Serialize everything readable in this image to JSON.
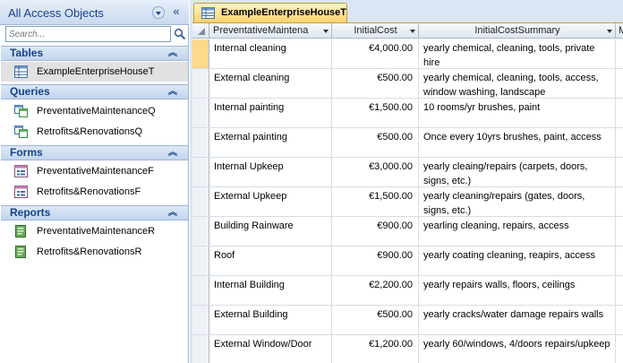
{
  "nav": {
    "title": "All Access Objects",
    "collapse_glyph": "«",
    "search_placeholder": "Search...",
    "groups": [
      {
        "label": "Tables",
        "items": [
          "ExampleEnterpriseHouseT"
        ]
      },
      {
        "label": "Queries",
        "items": [
          "PreventativeMaintenanceQ",
          "Retrofits&RenovationsQ"
        ]
      },
      {
        "label": "Forms",
        "items": [
          "PreventativeMaintenanceF",
          "Retrofits&RenovationsF"
        ]
      },
      {
        "label": "Reports",
        "items": [
          "PreventativeMaintenanceR",
          "Retrofits&RenovationsR"
        ]
      }
    ],
    "selected_item": "ExampleEnterpriseHouseT"
  },
  "document": {
    "tab_label": "ExampleEnterpriseHouseT",
    "columns": [
      "PreventativeMaintena",
      "InitialCost",
      "InitialCostSummary",
      "M"
    ],
    "rows": [
      {
        "name": "Internal cleaning",
        "cost": "€4,000.00",
        "summary": "yearly chemical, cleaning, tools, private hire"
      },
      {
        "name": "External cleaning",
        "cost": "€500.00",
        "summary": "yearly chemical, cleaning, tools, access, window washing, landscape"
      },
      {
        "name": "Internal painting",
        "cost": "€1,500.00",
        "summary": "10 rooms/yr brushes, paint"
      },
      {
        "name": "External painting",
        "cost": "€500.00",
        "summary": "Once every 10yrs brushes, paint, access"
      },
      {
        "name": "Internal Upkeep",
        "cost": "€3,000.00",
        "summary": "yearly cleaing/repairs (carpets, doors, signs, etc.)"
      },
      {
        "name": "External Upkeep",
        "cost": "€1,500.00",
        "summary": "yearly cleaning/repairs (gates, doors, signs, etc.)"
      },
      {
        "name": "Building Rainware",
        "cost": "€900.00",
        "summary": "yearling cleaning, repairs, access"
      },
      {
        "name": "Roof",
        "cost": "€900.00",
        "summary": "yearly coating cleaning, reapirs, access"
      },
      {
        "name": "Internal Building",
        "cost": "€2,200.00",
        "summary": "yearly repairs walls, floors, ceilings"
      },
      {
        "name": "External Building",
        "cost": "€500.00",
        "summary": "yearly cracks/water damage repairs walls"
      },
      {
        "name": "External Window/Door",
        "cost": "€1,200.00",
        "summary": "yearly 60/windows, 4/doors repairs/upkeep"
      }
    ]
  },
  "colors": {
    "nav_header": "#c9d9ef",
    "group_text": "#15428b",
    "tab_active": "#ffd36b",
    "current_row_selector": "#ffd98a",
    "workspace_bg": "#dbe6f4"
  },
  "icons": {
    "table": "table-icon",
    "query": "query-icon",
    "form": "form-icon",
    "report": "report-icon",
    "search": "search-icon"
  }
}
